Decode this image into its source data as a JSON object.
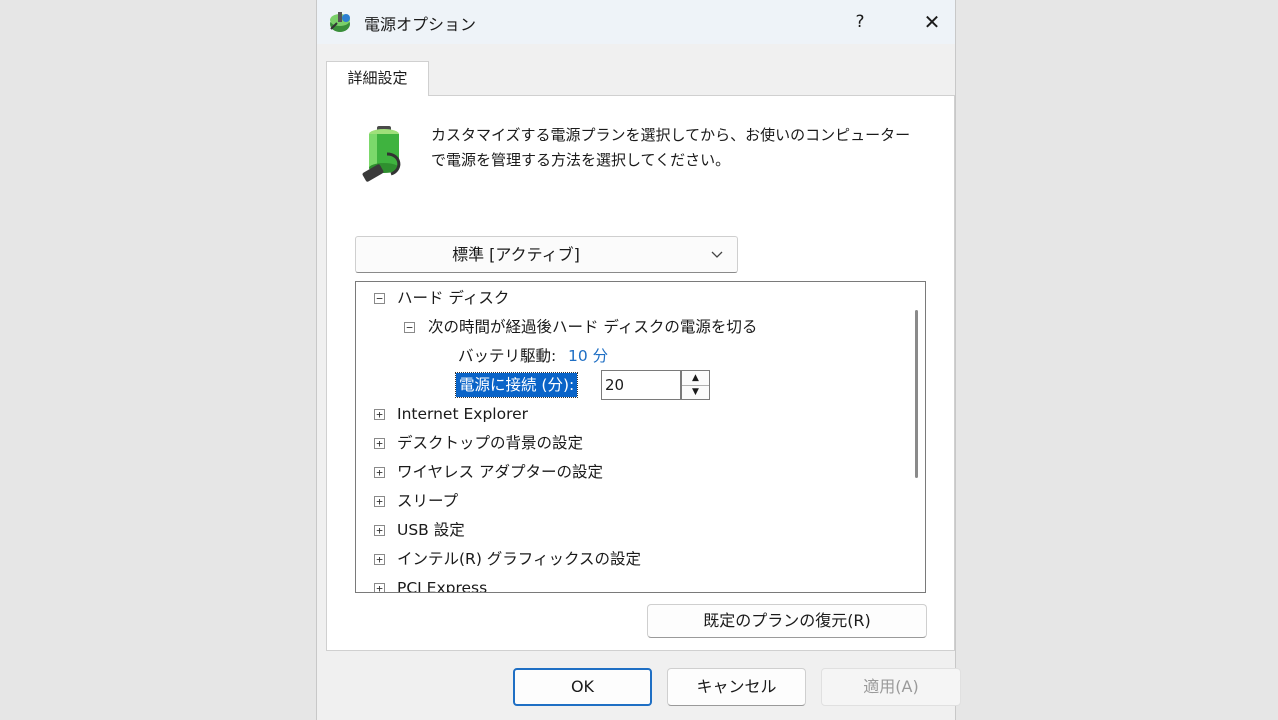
{
  "window": {
    "title": "電源オプション",
    "help": "?",
    "close": "✕"
  },
  "tab": {
    "label": "詳細設定"
  },
  "description": {
    "line1": "カスタマイズする電源プランを選択してから、お使いのコンピューター",
    "line2": "で電源を管理する方法を選択してください。"
  },
  "plan_select": {
    "value": "標準 [アクティブ]"
  },
  "tree": {
    "hard_disk": {
      "toggle": "−",
      "label": "ハード ディスク"
    },
    "turn_off": {
      "toggle": "−",
      "label": "次の時間が経過後ハード ディスクの電源を切る"
    },
    "on_battery": {
      "label": "バッテリ駆動:",
      "value": "10 分"
    },
    "plugged_in": {
      "label": "電源に接続 (分):",
      "value": "20"
    },
    "items": [
      {
        "toggle": "+",
        "label": "Internet Explorer"
      },
      {
        "toggle": "+",
        "label": "デスクトップの背景の設定"
      },
      {
        "toggle": "+",
        "label": "ワイヤレス アダプターの設定"
      },
      {
        "toggle": "+",
        "label": "スリープ"
      },
      {
        "toggle": "+",
        "label": "USB 設定"
      },
      {
        "toggle": "+",
        "label": "インテル(R) グラフィックスの設定"
      },
      {
        "toggle": "+",
        "label": "PCI Express"
      }
    ]
  },
  "buttons": {
    "restore": "既定のプランの復元(R)",
    "ok": "OK",
    "cancel": "キャンセル",
    "apply": "適用(A)"
  },
  "colors": {
    "accent": "#1f6fc4",
    "selection": "#0a64c8",
    "value_link": "#1f6fc4"
  },
  "icons": {
    "title": "power-options-icon",
    "battery": "battery-plug-icon"
  }
}
